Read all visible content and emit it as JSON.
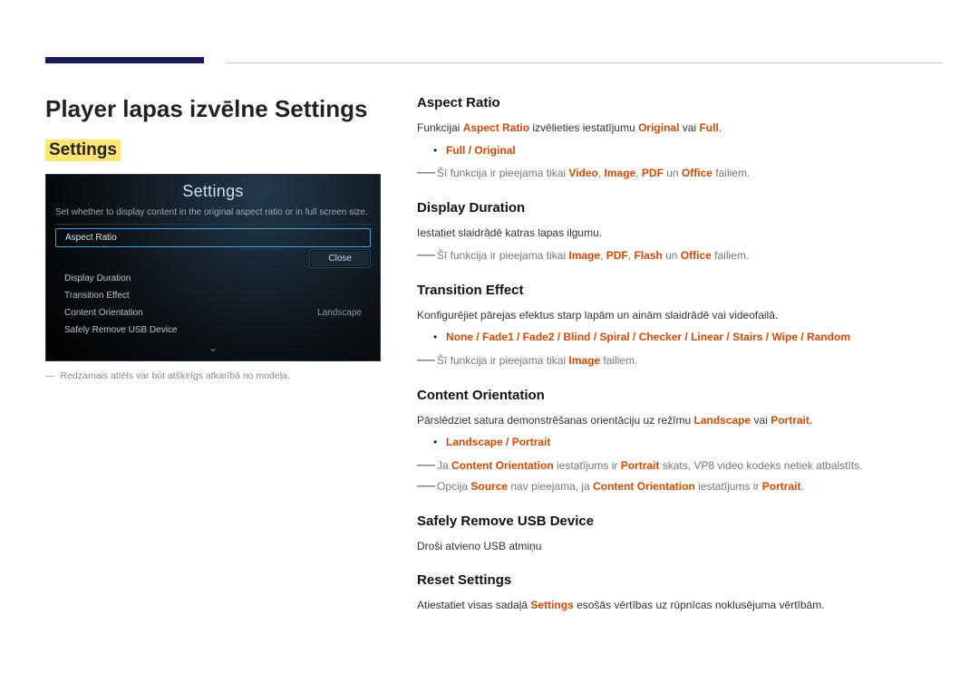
{
  "page_title": "Player lapas izvēlne Settings",
  "sub_title": "Settings",
  "mock": {
    "title": "Settings",
    "desc": "Set whether to display content in the original aspect ratio or in full screen size.",
    "rows": {
      "r0": "Aspect Ratio",
      "r1": "Display Duration",
      "r2": "Transition Effect",
      "r3": "Content Orientation",
      "r3v": "Landscape",
      "r4": "Safely Remove USB Device"
    },
    "close": "Close",
    "chevron": "⌄"
  },
  "left_footnote": "Redzamais attēls var būt atšķirīgs atkarībā no modeļa.",
  "aspect": {
    "h": "Aspect Ratio",
    "p_pre": "Funkcijai ",
    "p_hl1": "Aspect Ratio",
    "p_mid": " izvēlieties iestatījumu ",
    "p_hl2": "Original",
    "p_mid2": " vai ",
    "p_hl3": "Full",
    "p_end": ".",
    "bullet": "Full / Original",
    "note_pre": "Šī funkcija ir pieejama tikai ",
    "note_v": "Video",
    "note_i": "Image",
    "note_p": "PDF",
    "note_o": "Office",
    "note_end": " failiem."
  },
  "display": {
    "h": "Display Duration",
    "p": "Iestatiet slaidrādē katras lapas ilgumu.",
    "note_pre": "Šī funkcija ir pieejama tikai ",
    "note_i": "Image",
    "note_p": "PDF",
    "note_f": "Flash",
    "note_o": "Office",
    "note_end": " failiem."
  },
  "transition": {
    "h": "Transition Effect",
    "p": "Konfigurējiet pārejas efektus starp lapām un ainām slaidrādē vai videofailā.",
    "bullet": "None / Fade1 / Fade2 / Blind / Spiral / Checker / Linear / Stairs / Wipe / Random",
    "note_pre": "Šī funkcija ir pieejama tikai ",
    "note_i": "Image",
    "note_end": " failiem."
  },
  "orientation": {
    "h": "Content Orientation",
    "p_pre": "Pārslēdziet satura demonstrēšanas orientāciju uz režīmu ",
    "p_hl1": "Landscape",
    "p_mid": " vai ",
    "p_hl2": "Portrait",
    "p_end": ".",
    "bullet": "Landscape / Portrait",
    "n1_pre": "Ja ",
    "n1_hl1": "Content Orientation",
    "n1_mid": " iestatījums ir ",
    "n1_hl2": "Portrait",
    "n1_end": " skats, VP8 video kodeks netiek atbalstīts.",
    "n2_pre": "Opcija ",
    "n2_hl1": "Source",
    "n2_mid": " nav pieejama, ja ",
    "n2_hl2": "Content Orientation",
    "n2_mid2": " iestatījums ir ",
    "n2_hl3": "Portrait",
    "n2_end": "."
  },
  "usb": {
    "h": "Safely Remove USB Device",
    "p": "Droši atvieno USB atmiņu"
  },
  "reset": {
    "h": "Reset Settings",
    "p_pre": "Atiestatiet visas sadaļā ",
    "p_hl": "Settings",
    "p_end": " esošās vērtības uz rūpnīcas noklusējuma vērtībām."
  }
}
